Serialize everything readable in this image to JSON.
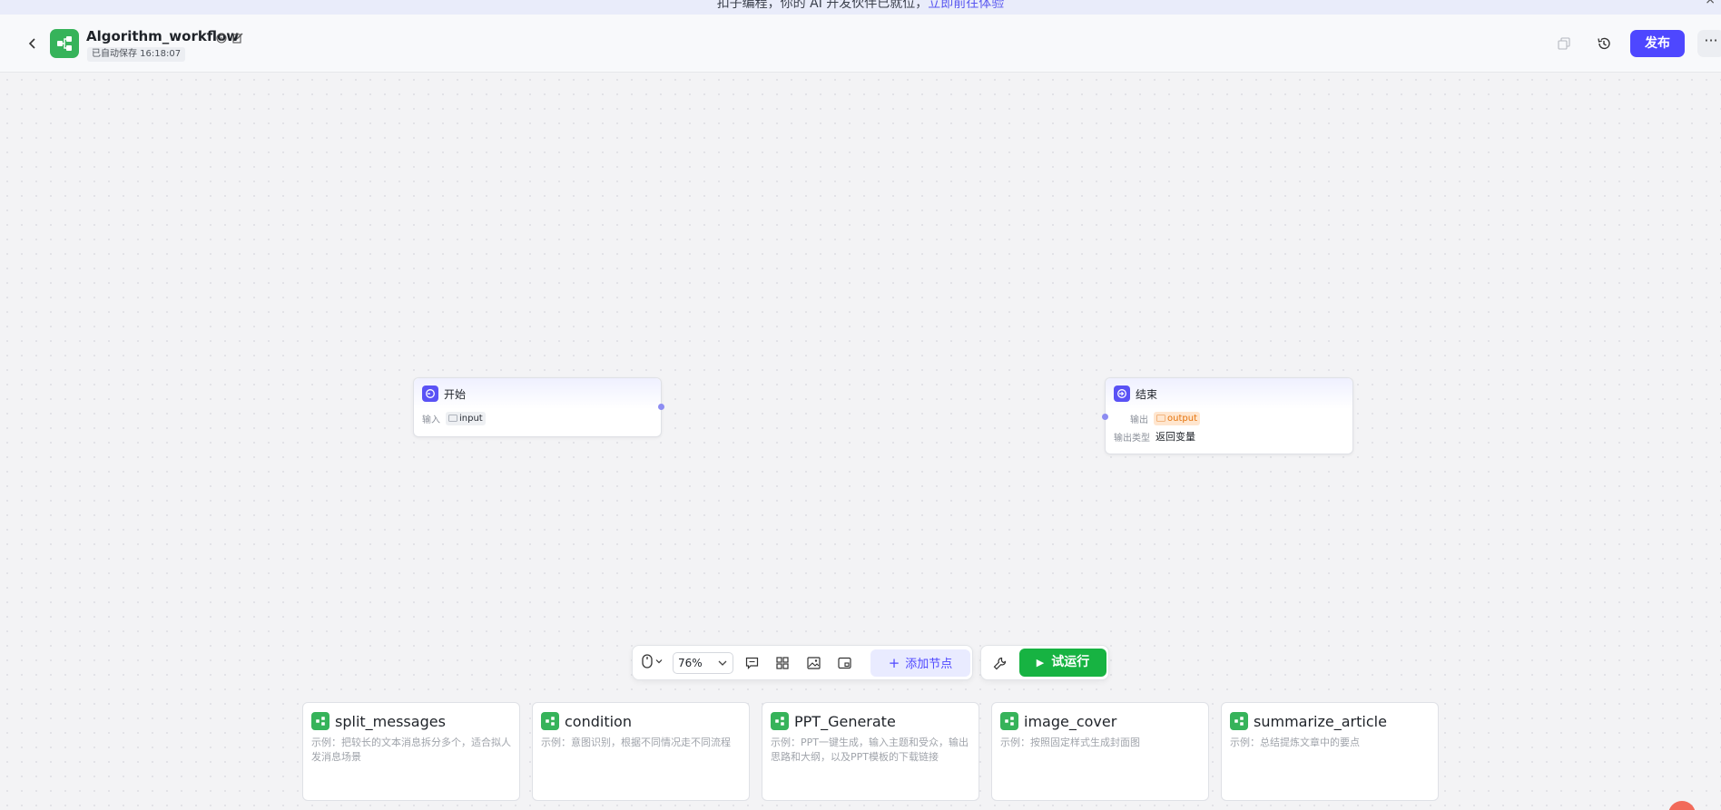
{
  "banner": {
    "text": "扣子编程，你的 AI 开发伙伴已就位，",
    "link": "立即前往体验"
  },
  "header": {
    "title": "Algorithm_workflow",
    "autosave": "已自动保存 16:18:07",
    "publish_label": "发布",
    "more_label": "···"
  },
  "nodes": {
    "start": {
      "title": "开始",
      "input_label": "输入",
      "input_var": "input"
    },
    "end": {
      "title": "结束",
      "output_label": "输出",
      "output_var": "output",
      "output_type_label": "输出类型",
      "output_type_value": "返回变量"
    }
  },
  "toolbar": {
    "zoom": "76%",
    "add_node_label": "添加节点",
    "run_label": "试运行"
  },
  "templates": [
    {
      "title": "split_messages",
      "desc": "示例：把较长的文本消息拆分多个，适合拟人发消息场景"
    },
    {
      "title": "condition",
      "desc": "示例：意图识别，根据不同情况走不同流程"
    },
    {
      "title": "PPT_Generate",
      "desc": "示例：PPT一键生成，输入主题和受众，输出思路和大纲，以及PPT模板的下载链接"
    },
    {
      "title": "image_cover",
      "desc": "示例：按照固定样式生成封面图"
    },
    {
      "title": "summarize_article",
      "desc": "示例：总结提炼文章中的要点"
    }
  ],
  "colors": {
    "accent": "#4e47ff",
    "run_green": "#17b342",
    "workflow_green": "#36b35a",
    "output_tag_bg": "#ffe6cf"
  }
}
